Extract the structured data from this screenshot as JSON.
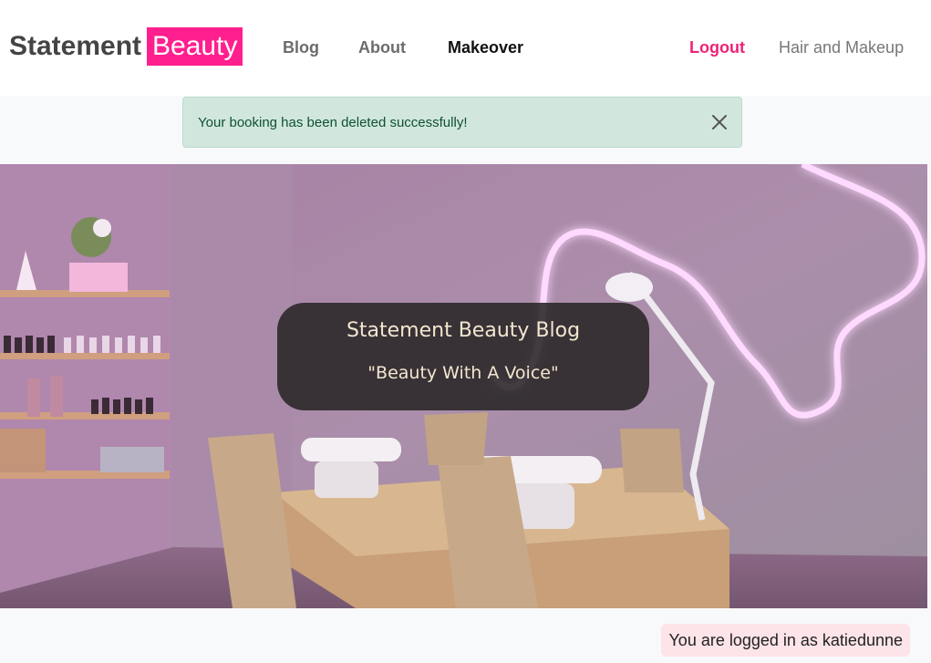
{
  "brand": {
    "name": "Statement",
    "accent": "Beauty",
    "accent_color": "#ff1f8e"
  },
  "nav": {
    "blog": "Blog",
    "about": "About",
    "makeover": "Makeover",
    "logout": "Logout",
    "hair_makeup": "Hair and Makeup"
  },
  "alert": {
    "message": "Your booking has been deleted successfully!",
    "close_icon": "close-icon"
  },
  "hero": {
    "title": "Statement Beauty Blog",
    "subtitle": "\"Beauty With A Voice\"",
    "image": "nail salon interior with neon pink wall light"
  },
  "footer": {
    "login_status": "You are logged in as katiedunne"
  }
}
